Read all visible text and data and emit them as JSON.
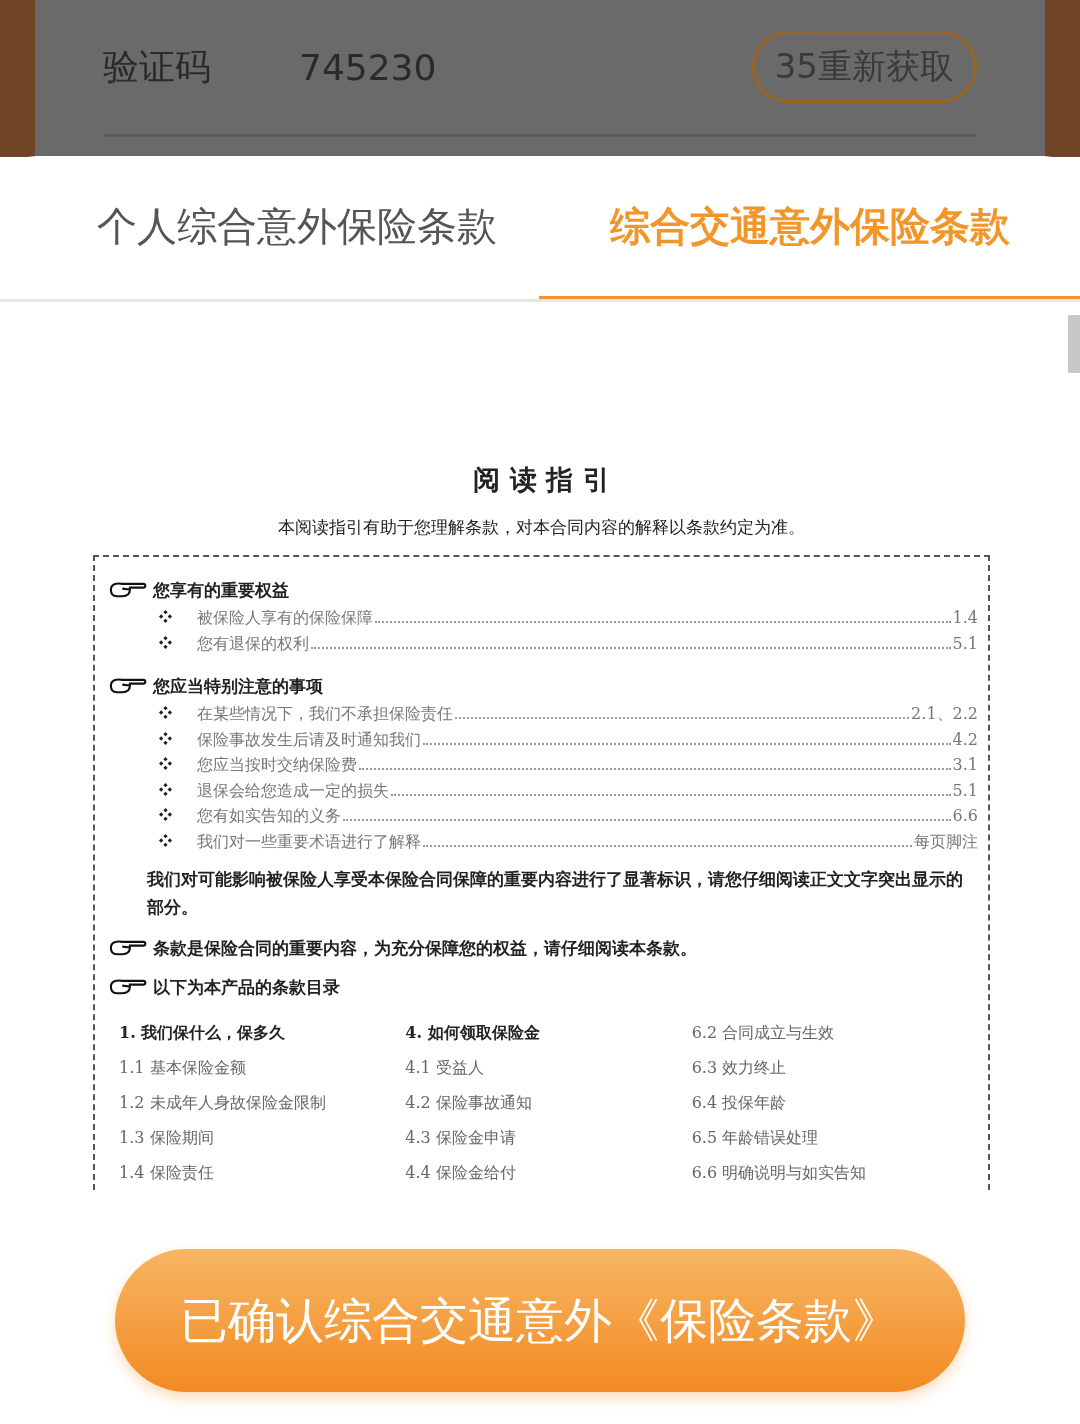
{
  "background_form": {
    "label": "验证码",
    "value": "745230",
    "resend_button": "35重新获取"
  },
  "tabs": [
    {
      "label": "个人综合意外保险条款",
      "selected": false
    },
    {
      "label": "综合交通意外保险条款",
      "selected": true
    }
  ],
  "document": {
    "title": "阅 读 指 引",
    "intro": "本阅读指引有助于您理解条款，对本合同内容的解释以条款约定为准。",
    "sections": [
      {
        "heading": "您享有的重要权益",
        "items": [
          {
            "text": "被保险人享有的保险保障",
            "ref": "1.4"
          },
          {
            "text": "您有退保的权利",
            "ref": "5.1"
          }
        ]
      },
      {
        "heading": "您应当特别注意的事项",
        "items": [
          {
            "text": "在某些情况下，我们不承担保险责任",
            "ref": "2.1、2.2"
          },
          {
            "text": "保险事故发生后请及时通知我们",
            "ref": "4.2"
          },
          {
            "text": "您应当按时交纳保险费",
            "ref": "3.1"
          },
          {
            "text": "退保会给您造成一定的损失",
            "ref": "5.1"
          },
          {
            "text": "您有如实告知的义务",
            "ref": "6.6"
          },
          {
            "text": "我们对一些重要术语进行了解释",
            "ref": "每页脚注"
          }
        ],
        "note": "我们对可能影响被保险人享受本保险合同保障的重要内容进行了显著标识，请您仔细阅读正文文字突出显示的部分。"
      },
      {
        "heading": "条款是保险合同的重要内容，为充分保障您的权益，请仔细阅读本条款。"
      },
      {
        "heading": "以下为本产品的条款目录",
        "toc": [
          [
            {
              "kind": "chapter",
              "text": "1. 我们保什么，保多久"
            },
            {
              "kind": "entry",
              "text": "1.1 基本保险金额"
            },
            {
              "kind": "entry",
              "text": "1.2 未成年人身故保险金限制"
            },
            {
              "kind": "entry",
              "text": "1.3 保险期间"
            },
            {
              "kind": "entry",
              "text": "1.4 保险责任"
            }
          ],
          [
            {
              "kind": "chapter",
              "text": "4. 如何领取保险金"
            },
            {
              "kind": "entry",
              "text": "4.1 受益人"
            },
            {
              "kind": "entry",
              "text": "4.2 保险事故通知"
            },
            {
              "kind": "entry",
              "text": "4.3 保险金申请"
            },
            {
              "kind": "entry",
              "text": "4.4 保险金给付"
            }
          ],
          [
            {
              "kind": "entry",
              "text": "6.2 合同成立与生效"
            },
            {
              "kind": "entry",
              "text": "6.3 效力终止"
            },
            {
              "kind": "entry",
              "text": "6.4 投保年龄"
            },
            {
              "kind": "entry",
              "text": "6.5 年龄错误处理"
            },
            {
              "kind": "entry",
              "text": "6.6 明确说明与如实告知"
            }
          ]
        ]
      }
    ]
  },
  "confirm_button": "已确认综合交通意外《保险条款》"
}
